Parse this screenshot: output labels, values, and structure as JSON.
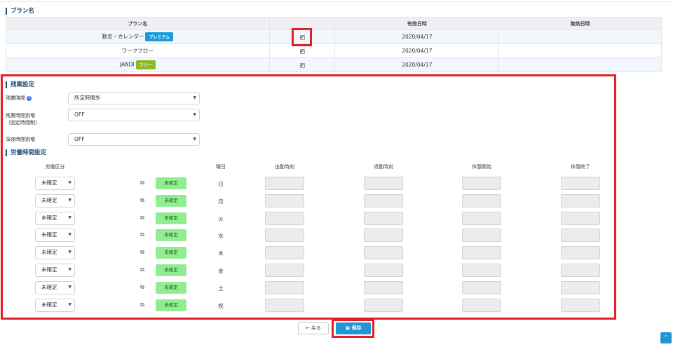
{
  "plan_section": {
    "title": "プラン名",
    "columns": [
      "プラン名",
      "",
      "有効日時",
      "無効日時"
    ],
    "rows": [
      {
        "name": "勤怠・カレンダー",
        "badge": "プレミアム",
        "badge_type": "premium",
        "checked": "✔",
        "valid_from": "2020/04/17",
        "valid_to": ""
      },
      {
        "name": "ワークフロー",
        "badge": "",
        "badge_type": "",
        "checked": "✔",
        "valid_from": "2020/04/17",
        "valid_to": ""
      },
      {
        "name": "JANDI",
        "badge": "フリー",
        "badge_type": "free",
        "checked": "✔",
        "valid_from": "2020/04/17",
        "valid_to": ""
      }
    ]
  },
  "overtime": {
    "title": "残業設定",
    "overtime_label": "残業時間",
    "overtime_value": "所定時間外",
    "premium_label_1": "残業時間割増",
    "premium_label_2": "（固定時間制）",
    "premium_value": "OFF",
    "night_label": "深夜時間割増",
    "night_value": "OFF"
  },
  "labor": {
    "title": "労働時間設定",
    "headers": {
      "kind": "労働区分",
      "day": "曜日",
      "start": "出勤時刻",
      "end": "退勤時刻",
      "break_start": "休憩開始",
      "break_end": "休憩終了"
    },
    "rows": [
      {
        "kind": "未確定",
        "status": "未確定",
        "day": "日"
      },
      {
        "kind": "未確定",
        "status": "未確定",
        "day": "月"
      },
      {
        "kind": "未確定",
        "status": "未確定",
        "day": "火"
      },
      {
        "kind": "未確定",
        "status": "未確定",
        "day": "水"
      },
      {
        "kind": "未確定",
        "status": "未確定",
        "day": "木"
      },
      {
        "kind": "未確定",
        "status": "未確定",
        "day": "金"
      },
      {
        "kind": "未確定",
        "status": "未確定",
        "day": "土"
      },
      {
        "kind": "未確定",
        "status": "未確定",
        "day": "祝"
      }
    ]
  },
  "actions": {
    "back_label": "← 戻る",
    "save_label": "保存",
    "save_icon": "floppy-disk-icon",
    "scroll_top_icon": "double-chevron-up-icon"
  },
  "colors": {
    "accent": "#2196d3",
    "highlight": "#e21f26",
    "status_green": "#90ee90",
    "premium": "#1a9ad8",
    "free": "#8aba23"
  }
}
